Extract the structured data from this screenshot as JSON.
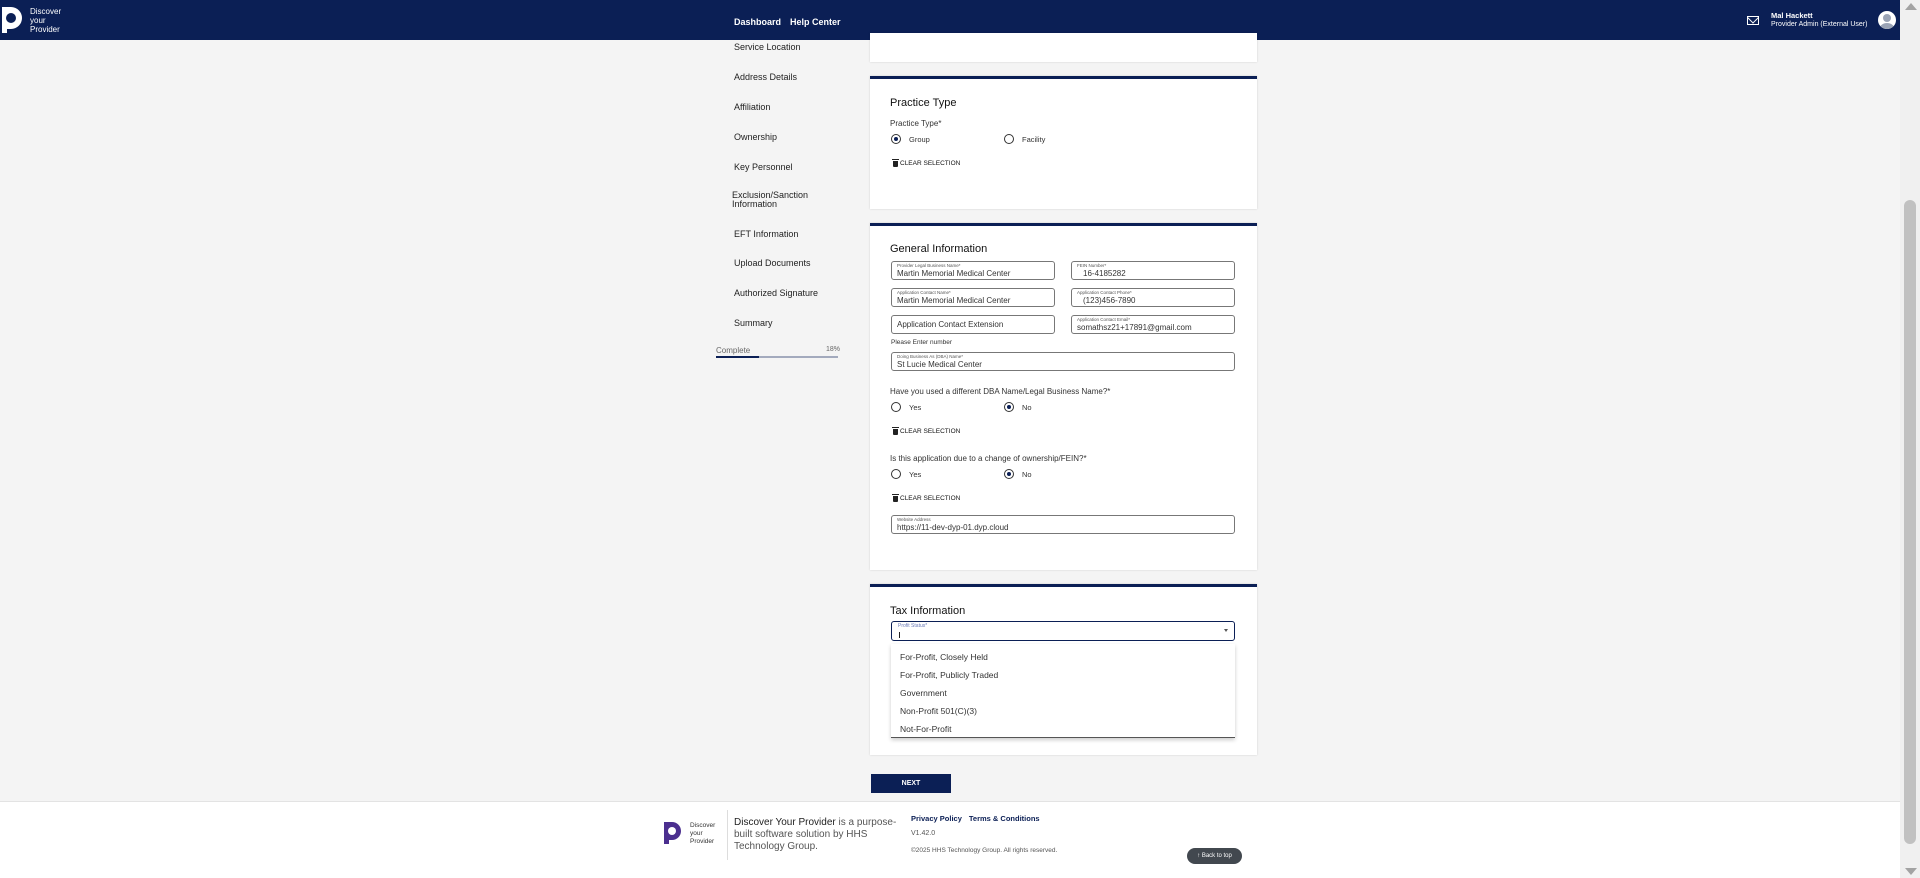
{
  "header": {
    "logo_lines": [
      "Discover",
      "your",
      "Provider"
    ],
    "nav": [
      "Dashboard",
      "Help Center"
    ],
    "user_name": "Mal Hackett",
    "user_role": "Provider Admin (External User)"
  },
  "sidebar": {
    "items": [
      "Service Location",
      "Address Details",
      "Affiliation",
      "Ownership",
      "Key Personnel",
      "Exclusion/Sanction Information",
      "EFT Information",
      "Upload Documents",
      "Authorized Signature",
      "Summary"
    ],
    "progress_label": "Complete",
    "progress_text": "18%",
    "progress_value": 0.35
  },
  "practice_type": {
    "title": "Practice Type",
    "question": "Practice Type*",
    "options": [
      "Group",
      "Facility"
    ],
    "selected": "Group",
    "clear": "CLEAR SELECTION"
  },
  "general": {
    "title": "General Information",
    "legal_name_label": "Provider Legal Business Name*",
    "legal_name": "Martin Memorial Medical Center",
    "fein_label": "FEIN Number*",
    "fein": "16-4185282",
    "contact_name_label": "Application Contact Name*",
    "contact_name": "Martin Memorial Medical Center",
    "phone_label": "Application Contact Phone*",
    "phone": "(123)456-7890",
    "extension_placeholder": "Application Contact Extension",
    "email_label": "Application Contact Email*",
    "email": "somathsz21+17891@gmail.com",
    "extension_hint": "Please Enter number",
    "dba_label": "Doing Business As (DBA) Name*",
    "dba": "St Lucie Medical Center",
    "q1": "Have you used a different DBA Name/Legal Business Name?*",
    "q1_options": [
      "Yes",
      "No"
    ],
    "q1_selected": "No",
    "q2": "Is this application due to a change of ownership/FEIN?*",
    "q2_options": [
      "Yes",
      "No"
    ],
    "q2_selected": "No",
    "clear": "CLEAR SELECTION",
    "website_label": "Website Address",
    "website": "https://11-dev-dyp-01.dyp.cloud"
  },
  "tax": {
    "title": "Tax Information",
    "profit_label": "Profit Status*",
    "options": [
      "For-Profit, Closely Held",
      "For-Profit, Publicly Traded",
      "Government",
      "Non-Profit 501(C)(3)",
      "Not-For-Profit"
    ]
  },
  "next_label": "NEXT",
  "footer": {
    "logo_lines": [
      "Discover",
      "your",
      "Provider"
    ],
    "brand": "Discover Your Provider",
    "desc": " is a purpose-built software solution by HHS Technology Group.",
    "links": [
      "Privacy Policy",
      "Terms & Conditions"
    ],
    "version": "V1.42.0",
    "copyright": "©2025 HHS Technology Group. All rights reserved.",
    "back_to_top": "Back to top"
  },
  "colors": {
    "brand": "#0b1f55"
  }
}
